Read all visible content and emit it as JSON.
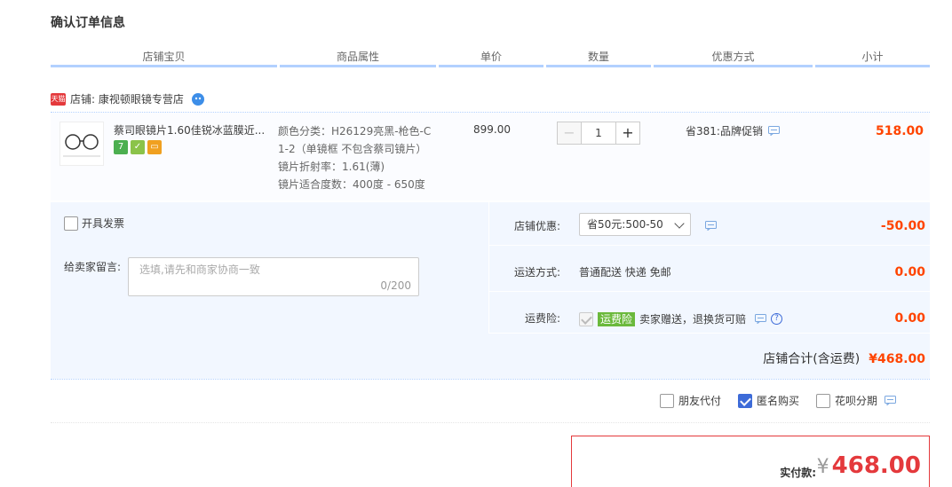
{
  "page_title": "确认订单信息",
  "columns": [
    "店铺宝贝",
    "商品属性",
    "单价",
    "数量",
    "优惠方式",
    "小计"
  ],
  "shop": {
    "badge": "天猫",
    "label": "店铺: 康视顿眼镜专营店"
  },
  "item": {
    "title": "蔡司眼镜片1.60佳锐冰蓝膜近...",
    "attrs": [
      "颜色分类：H26129亮黑-枪色-C",
      "1-2（单镜框 不包含蔡司镜片）",
      "镜片折射率：1.61(薄)",
      "镜片适合度数：400度 - 650度"
    ],
    "badges": [
      "7",
      "✓",
      "▭"
    ],
    "price": "899.00",
    "quantity": "1",
    "promo": "省381:品牌促销",
    "subtotal": "518.00"
  },
  "invoice": {
    "label": "开具发票",
    "checked": false
  },
  "message": {
    "label": "给卖家留言:",
    "placeholder": "选填,请先和商家协商一致",
    "count": "0/200"
  },
  "shop_discount": {
    "label": "店铺优惠:",
    "selected": "省50元:500-50",
    "value": "-50.00"
  },
  "shipping": {
    "label": "运送方式:",
    "method": "普通配送 快递 免邮",
    "value": "0.00"
  },
  "insurance": {
    "label": "运费险:",
    "tag": "运费险",
    "desc": "卖家赠送，退换货可赔",
    "value": "0.00"
  },
  "shop_total": {
    "label": "店铺合计(含运费)",
    "amount": "¥468.00"
  },
  "options": [
    {
      "label": "朋友代付",
      "checked": false
    },
    {
      "label": "匿名购买",
      "checked": true
    },
    {
      "label": "花呗分期",
      "checked": false
    }
  ],
  "payment": {
    "label": "实付款:",
    "currency": "¥",
    "amount": "468.00"
  },
  "colors": {
    "accent_red": "#f40",
    "header_bar": "#b2d1ff",
    "panel_bg": "#f2f7ff"
  }
}
